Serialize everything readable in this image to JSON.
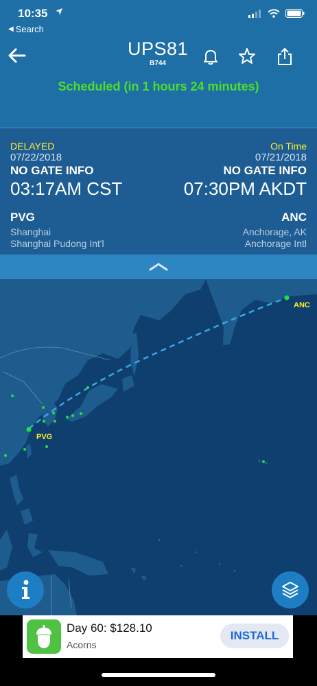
{
  "status_bar": {
    "time": "10:35",
    "back_label": "Search"
  },
  "header": {
    "flight": "UPS81",
    "aircraft": "B744",
    "status_text": "Scheduled (in 1 hours 24 minutes)",
    "icons": [
      "back-arrow-icon",
      "bell-icon",
      "star-icon",
      "share-icon"
    ]
  },
  "departure": {
    "status": "DELAYED",
    "date": "07/22/2018",
    "gate": "NO GATE INFO",
    "time": "03:17AM CST",
    "code": "PVG",
    "city": "Shanghai",
    "airport": "Shanghai Pudong Int'l"
  },
  "arrival": {
    "status": "On Time",
    "date": "07/21/2018",
    "gate": "NO GATE INFO",
    "time": "07:30PM AKDT",
    "code": "ANC",
    "city": "Anchorage, AK",
    "airport": "Anchorage Intl"
  },
  "map": {
    "origin_label": "PVG",
    "destination_label": "ANC",
    "info_button": "info-icon",
    "layers_button": "layers-icon"
  },
  "ad": {
    "title": "Day 60: $128.10",
    "advertiser": "Acorns",
    "cta": "INSTALL"
  },
  "colors": {
    "header_bg": "#1e6fa6",
    "info_bg": "#1d5d93",
    "scheduled_green": "#4ede2a",
    "status_yellow": "#ffee2c",
    "ocean": "#0e3f6e",
    "land": "#1f5c8e",
    "route_dash": "#39a6e8"
  }
}
